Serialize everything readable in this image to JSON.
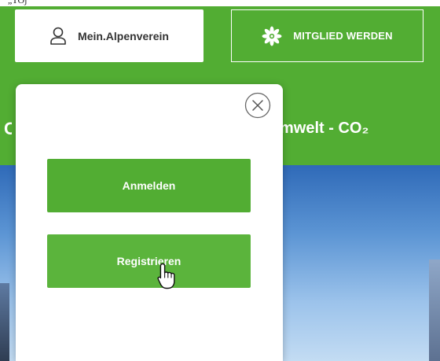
{
  "header": {
    "member_button_label": "Mein.Alpenverein",
    "join_button_label": "MITGLIED WERDEN",
    "nav_partial_text": "mwelt - CO₂",
    "nav_partial_left": "C",
    "top_strip_partial": "„TOj"
  },
  "modal": {
    "login_label": "Anmelden",
    "register_label": "Registrieren"
  },
  "icons": {
    "member": "user-icon",
    "join": "edelweiss-icon",
    "close": "close-icon",
    "cursor": "hand-pointer-icon"
  },
  "colors": {
    "brand_green": "#52ad33",
    "white": "#ffffff"
  }
}
